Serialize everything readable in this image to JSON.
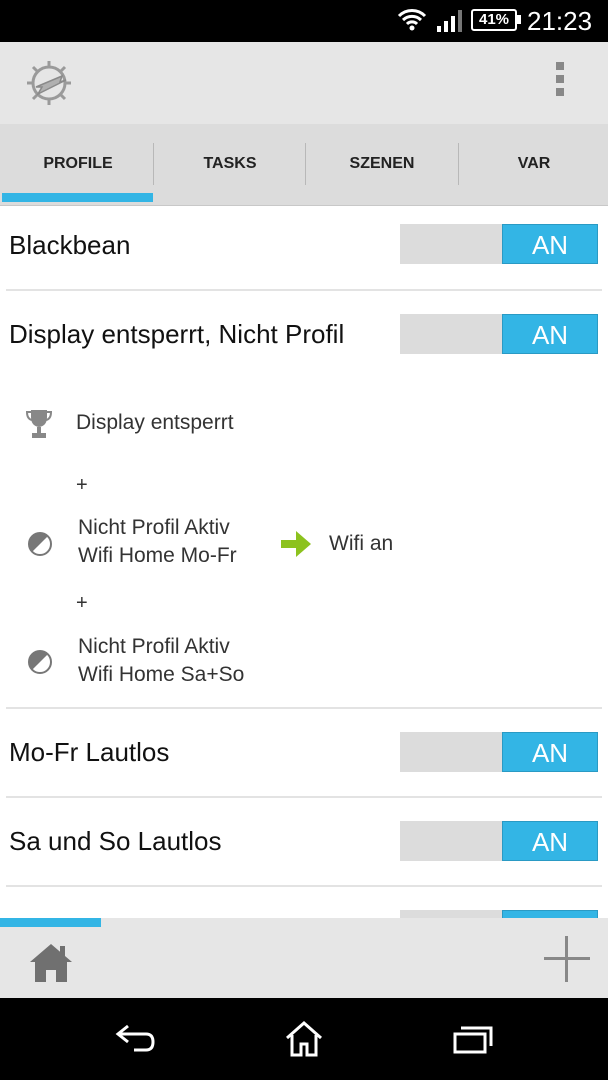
{
  "status_bar": {
    "battery": "41%",
    "time": "21:23"
  },
  "tabs": [
    {
      "label": "PROFILE",
      "active": true
    },
    {
      "label": "TASKS"
    },
    {
      "label": "SZENEN"
    },
    {
      "label": "VAR"
    }
  ],
  "profiles": [
    {
      "name": "Blackbean",
      "toggle": "AN"
    },
    {
      "name": "Display entsperrt, Nicht Profil",
      "toggle": "AN",
      "details": {
        "state1": "Display entsperrt",
        "plus1": "+",
        "state2_line1": "Nicht Profil Aktiv",
        "state2_line2": "Wifi Home Mo-Fr",
        "task": "Wifi an",
        "plus2": "+",
        "state3_line1": "Nicht Profil Aktiv",
        "state3_line2": "Wifi Home Sa+So"
      }
    },
    {
      "name": "Mo-Fr Lautlos",
      "toggle": "AN"
    },
    {
      "name": "Sa und So Lautlos",
      "toggle": "AN"
    }
  ],
  "icons": {
    "accent_color": "#33b5e5",
    "task_arrow_color": "#8cc21e"
  }
}
